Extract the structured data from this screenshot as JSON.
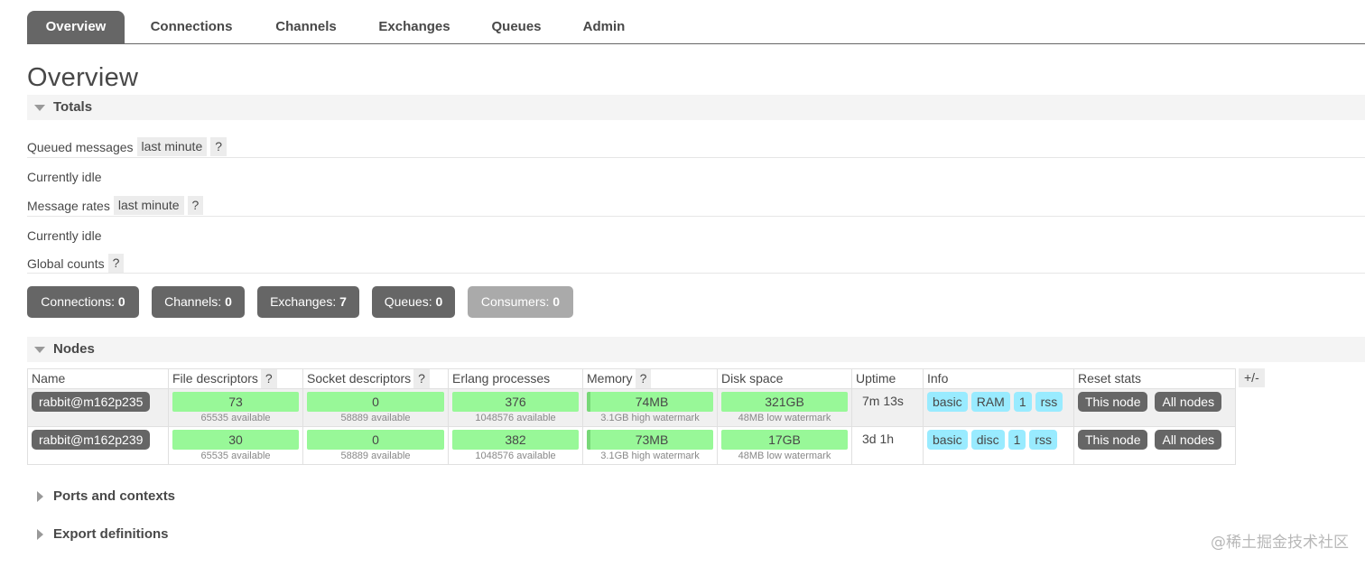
{
  "tabs": [
    {
      "label": "Overview",
      "active": true
    },
    {
      "label": "Connections"
    },
    {
      "label": "Channels"
    },
    {
      "label": "Exchanges"
    },
    {
      "label": "Queues"
    },
    {
      "label": "Admin"
    }
  ],
  "page_title": "Overview",
  "totals": {
    "label": "Totals",
    "queued_messages": {
      "label": "Queued messages",
      "range": "last minute",
      "help": "?",
      "status": "Currently idle"
    },
    "message_rates": {
      "label": "Message rates",
      "range": "last minute",
      "help": "?",
      "status": "Currently idle"
    },
    "global_counts": {
      "label": "Global counts",
      "help": "?"
    },
    "counts": [
      {
        "label": "Connections:",
        "value": "0"
      },
      {
        "label": "Channels:",
        "value": "0"
      },
      {
        "label": "Exchanges:",
        "value": "7"
      },
      {
        "label": "Queues:",
        "value": "0"
      },
      {
        "label": "Consumers:",
        "value": "0",
        "disabled": true
      }
    ]
  },
  "nodes": {
    "label": "Nodes",
    "columns_toggle": "+/-",
    "columns": [
      {
        "label": "Name"
      },
      {
        "label": "File descriptors",
        "help": "?"
      },
      {
        "label": "Socket descriptors",
        "help": "?"
      },
      {
        "label": "Erlang processes"
      },
      {
        "label": "Memory",
        "help": "?"
      },
      {
        "label": "Disk space"
      },
      {
        "label": "Uptime"
      },
      {
        "label": "Info"
      },
      {
        "label": "Reset stats"
      }
    ],
    "rows": [
      {
        "name": "rabbit@m162p235",
        "file_descriptors": {
          "value": "73",
          "sub": "65535 available"
        },
        "socket_descriptors": {
          "value": "0",
          "sub": "58889 available"
        },
        "erlang_processes": {
          "value": "376",
          "sub": "1048576 available"
        },
        "memory": {
          "value": "74MB",
          "sub": "3.1GB high watermark"
        },
        "disk_space": {
          "value": "321GB",
          "sub": "48MB low watermark"
        },
        "uptime": "7m 13s",
        "info": [
          "basic",
          "RAM",
          "1",
          "rss"
        ],
        "reset": [
          "This node",
          "All nodes"
        ]
      },
      {
        "name": "rabbit@m162p239",
        "file_descriptors": {
          "value": "30",
          "sub": "65535 available"
        },
        "socket_descriptors": {
          "value": "0",
          "sub": "58889 available"
        },
        "erlang_processes": {
          "value": "382",
          "sub": "1048576 available"
        },
        "memory": {
          "value": "73MB",
          "sub": "3.1GB high watermark"
        },
        "disk_space": {
          "value": "17GB",
          "sub": "48MB low watermark"
        },
        "uptime": "3d 1h",
        "info": [
          "basic",
          "disc",
          "1",
          "rss"
        ],
        "reset": [
          "This node",
          "All nodes"
        ]
      }
    ]
  },
  "ports_and_contexts": {
    "label": "Ports and contexts"
  },
  "export_definitions": {
    "label": "Export definitions"
  },
  "watermark": "@稀土掘金技术社区"
}
